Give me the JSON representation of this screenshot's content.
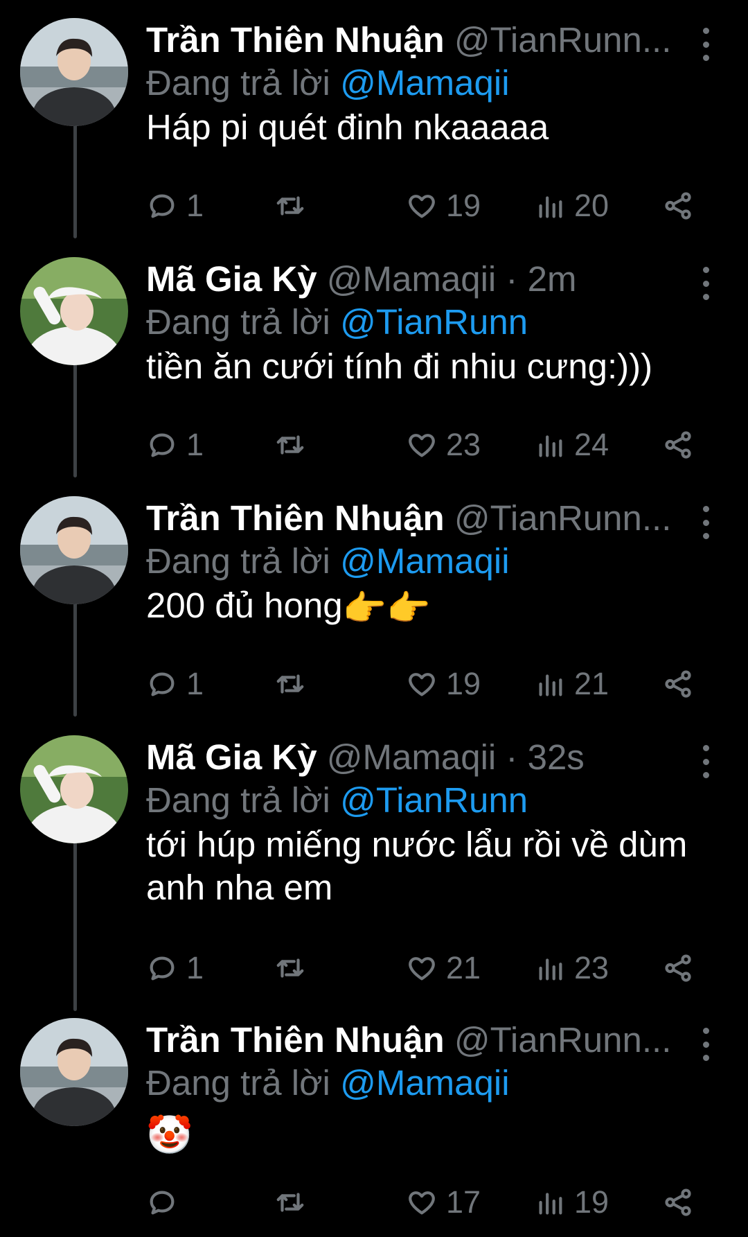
{
  "tweets": [
    {
      "name": "Trần Thiên Nhuận",
      "handle": "@TianRunn...",
      "replying_prefix": "Đang trả lời",
      "replying_to": "@Mamaqii",
      "text": "Háp pi quét đinh nkaaaaa",
      "replies": "1",
      "likes": "19",
      "views": "20"
    },
    {
      "name": "Mã Gia Kỳ",
      "handle": "@Mamaqii · 2m",
      "replying_prefix": "Đang trả lời",
      "replying_to": "@TianRunn",
      "text": "tiền ăn cưới tính đi nhiu cưng:)))",
      "replies": "1",
      "likes": "23",
      "views": "24"
    },
    {
      "name": "Trần Thiên Nhuận",
      "handle": "@TianRunn...",
      "replying_prefix": "Đang trả lời",
      "replying_to": "@Mamaqii",
      "text": "200 đủ hong",
      "text_emoji": "👉👉",
      "replies": "1",
      "likes": "19",
      "views": "21"
    },
    {
      "name": "Mã Gia Kỳ",
      "handle": "@Mamaqii · 32s",
      "replying_prefix": "Đang trả lời",
      "replying_to": "@TianRunn",
      "text": "tới húp miếng nước lẩu rồi về dùm anh nha em",
      "replies": "1",
      "likes": "21",
      "views": "23"
    },
    {
      "name": "Trần Thiên Nhuận",
      "handle": "@TianRunn...",
      "replying_prefix": "Đang trả lời",
      "replying_to": "@Mamaqii",
      "text_emoji": "🤡",
      "replies": "",
      "likes": "17",
      "views": "19"
    }
  ],
  "icons": {
    "reply": "reply-icon",
    "retweet": "retweet-icon",
    "like": "heart-icon",
    "views": "views-icon",
    "share": "share-icon",
    "more": "more-vertical-icon"
  },
  "colors": {
    "background": "#000000",
    "text": "#ffffff",
    "muted": "#71767b",
    "mention": "#1d9bf0"
  }
}
